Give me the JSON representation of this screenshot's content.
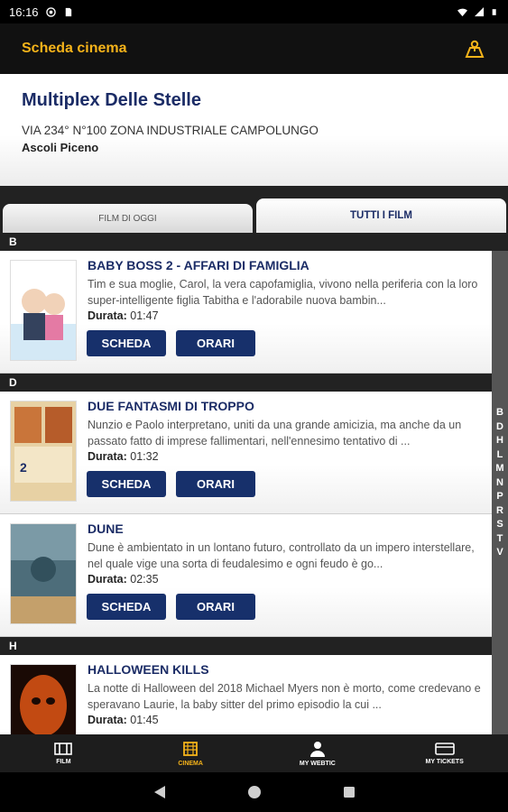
{
  "status": {
    "time": "16:16"
  },
  "appbar": {
    "title": "Scheda cinema",
    "map_icon": "map-icon"
  },
  "cinema": {
    "name": "Multiplex Delle Stelle",
    "address": "VIA 234° N°100 ZONA INDUSTRIALE CAMPOLUNGO",
    "city": "Ascoli Piceno"
  },
  "tabs": {
    "today": "FILM DI OGGI",
    "all": "TUTTI I FILM"
  },
  "labels": {
    "duration": "Durata:",
    "scheda": "SCHEDA",
    "orari": "ORARI"
  },
  "sections": [
    {
      "letter": "B",
      "movies": [
        {
          "title": "BABY BOSS 2 - AFFARI DI FAMIGLIA",
          "description": "Tim e sua moglie, Carol, la vera capofamiglia, vivono nella periferia con la loro super-intelligente figlia Tabitha e l'adorabile nuova bambin...",
          "duration": "01:47",
          "poster_color": "#6bb1e0"
        }
      ]
    },
    {
      "letter": "D",
      "movies": [
        {
          "title": "DUE FANTASMI DI TROPPO",
          "description": "Nunzio e Paolo interpretano, uniti da una grande amicizia, ma anche da un passato fatto di imprese fallimentari, nell'ennesimo tentativo di ...",
          "duration": "01:32",
          "poster_color": "#c9753a"
        },
        {
          "title": "DUNE",
          "description": "Dune è ambientato in un lontano futuro, controllato da un impero interstellare, nel quale vige una sorta di feudalesimo e ogni feudo è go...",
          "duration": "02:35",
          "poster_color": "#5e7f8c"
        }
      ]
    },
    {
      "letter": "H",
      "movies": [
        {
          "title": "HALLOWEEN KILLS",
          "description": "La notte di Halloween del 2018 Michael Myers non è morto, come credevano e speravano Laurie, la baby sitter del primo episodio la cui ...",
          "duration": "01:45",
          "poster_color": "#c24a12"
        }
      ]
    }
  ],
  "index_letters": [
    "B",
    "D",
    "H",
    "L",
    "M",
    "N",
    "P",
    "R",
    "S",
    "T",
    "V"
  ],
  "bottom_nav": [
    {
      "label": "FILM",
      "icon": "film-icon"
    },
    {
      "label": "CINEMA",
      "icon": "cinema-icon",
      "active": true
    },
    {
      "label": "MY WEBTIC",
      "icon": "user-icon"
    },
    {
      "label": "MY TICKETS",
      "icon": "ticket-icon"
    }
  ],
  "colors": {
    "accent": "#f5b31a",
    "brand": "#1b2c66",
    "button": "#17306b"
  }
}
